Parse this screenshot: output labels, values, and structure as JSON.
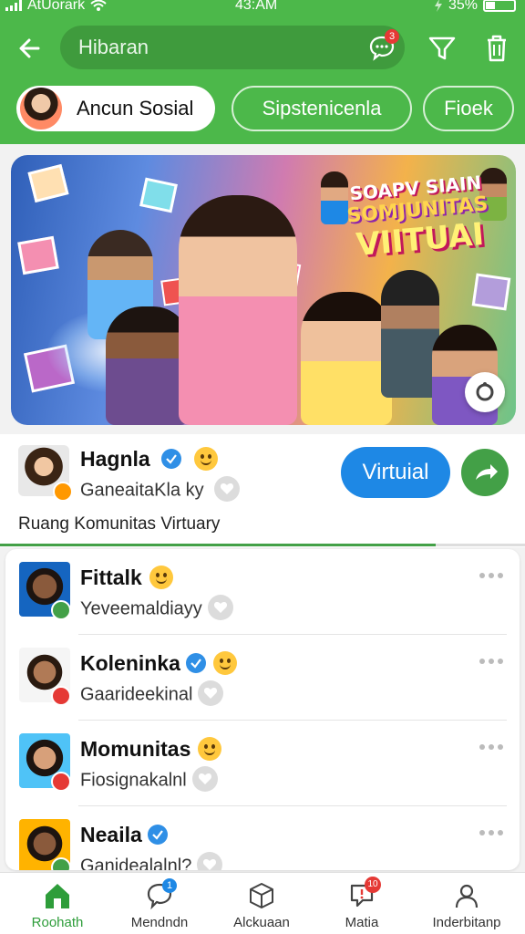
{
  "status_bar": {
    "carrier": "AtUorark",
    "time": "43:AM",
    "battery": "35%"
  },
  "search": {
    "value": "",
    "placeholder": "Hibaran",
    "chat_badge": "3"
  },
  "tabs": [
    {
      "label": "Ancun Sosial",
      "active": true
    },
    {
      "label": "Sipstenicenla",
      "active": false
    },
    {
      "label": "Fioek",
      "active": false
    }
  ],
  "banner": {
    "line1": "SOAPV SIAIN",
    "line2": "SOMJUNITAS",
    "line3": "VIITUAI"
  },
  "featured": {
    "name": "Hagnla",
    "subtitle": "GaneaitaKla ky",
    "description": "Ruang Komunitas  Virtuary",
    "button_label": "Virtuial",
    "progress": 0.83
  },
  "list": [
    {
      "name": "Fittalk",
      "subtitle": "Yeveemaldiayy",
      "verified": false,
      "status_color": "#43a047"
    },
    {
      "name": "Koleninka",
      "subtitle": "Gaaridee​kinal",
      "verified": true,
      "status_color": "#e53935"
    },
    {
      "name": "Momunitas",
      "subtitle": "Fiosignakalnl",
      "verified": false,
      "status_color": "#e53935"
    },
    {
      "name": "Neaila",
      "subtitle": "Ganideala​lnl?",
      "verified": true,
      "status_color": "#43a047"
    }
  ],
  "bottom_nav": [
    {
      "label": "Roohath",
      "active": true,
      "badge": ""
    },
    {
      "label": "Mendndn",
      "active": false,
      "badge": "1"
    },
    {
      "label": "Alckuaan",
      "active": false,
      "badge": ""
    },
    {
      "label": "Matia",
      "active": false,
      "badge": "10"
    },
    {
      "label": "Inderbitanp",
      "active": false,
      "badge": ""
    }
  ],
  "colors": {
    "primary": "#4cb84a",
    "accent_blue": "#1e88e5",
    "active_nav": "#2e9d3a"
  }
}
